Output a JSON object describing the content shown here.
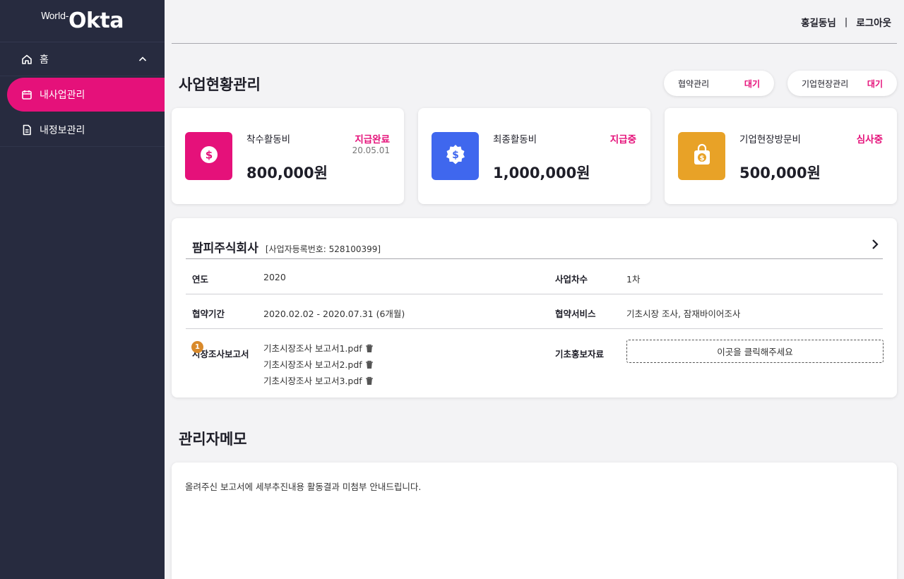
{
  "sidebar": {
    "logo_prefix": "World-",
    "logo_main": "Okta",
    "items": [
      {
        "label": "홈"
      },
      {
        "label": "내사업관리"
      },
      {
        "label": "내정보관리"
      }
    ]
  },
  "header": {
    "user": "홍길동님",
    "separator": "|",
    "logout": "로그아웃"
  },
  "page": {
    "title": "사업현황관리",
    "pills": [
      {
        "label": "협약관리",
        "status": "대기"
      },
      {
        "label": "기업현장관리",
        "status": "대기"
      }
    ]
  },
  "stats": [
    {
      "label": "착수활동비",
      "status": "지급완료",
      "date": "20.05.01",
      "amount": "800,000원",
      "color": "#e5117a",
      "icon": "dollar-coin-icon"
    },
    {
      "label": "최종활동비",
      "status": "지급중",
      "date": "",
      "amount": "1,000,000원",
      "color": "#3f67ee",
      "icon": "dollar-badge-icon"
    },
    {
      "label": "기업현장방문비",
      "status": "심사중",
      "date": "",
      "amount": "500,000원",
      "color": "#e8a227",
      "icon": "shopping-bag-icon"
    }
  ],
  "company": {
    "name": "팜피주식회사",
    "reg": "[사업자등록번호: 528100399]",
    "year_label": "연도",
    "year": "2020",
    "round_label": "사업차수",
    "round": "1차",
    "period_label": "협약기간",
    "period": "2020.02.02 - 2020.07.31 (6개월)",
    "service_label": "협약서비스",
    "service": "기초시장 조사, 잠재바이어조사",
    "report_label": "시장조사보고서",
    "report_badge": "1",
    "files": [
      "기초시장조사 보고서1.pdf",
      "기초시장조사 보고서2.pdf",
      "기초시장조사 보고서3.pdf"
    ],
    "promo_label": "기초홍보자료",
    "dropzone": "이곳을 클릭해주세요"
  },
  "memo": {
    "title": "관리자메모",
    "text": "올려주신 보고서에 세부추진내용 활동결과 미첨부 안내드립니다."
  },
  "colors": {
    "accent": "#e5117a",
    "sidebar": "#272b3f",
    "badge": "#d98a2b"
  }
}
